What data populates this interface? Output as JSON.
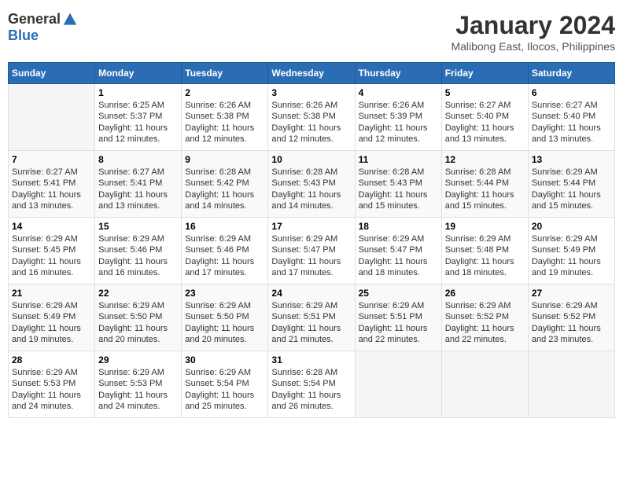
{
  "logo": {
    "general": "General",
    "blue": "Blue"
  },
  "title": "January 2024",
  "subtitle": "Malibong East, Ilocos, Philippines",
  "days_header": [
    "Sunday",
    "Monday",
    "Tuesday",
    "Wednesday",
    "Thursday",
    "Friday",
    "Saturday"
  ],
  "weeks": [
    [
      {
        "day": "",
        "info": ""
      },
      {
        "day": "1",
        "info": "Sunrise: 6:25 AM\nSunset: 5:37 PM\nDaylight: 11 hours\nand 12 minutes."
      },
      {
        "day": "2",
        "info": "Sunrise: 6:26 AM\nSunset: 5:38 PM\nDaylight: 11 hours\nand 12 minutes."
      },
      {
        "day": "3",
        "info": "Sunrise: 6:26 AM\nSunset: 5:38 PM\nDaylight: 11 hours\nand 12 minutes."
      },
      {
        "day": "4",
        "info": "Sunrise: 6:26 AM\nSunset: 5:39 PM\nDaylight: 11 hours\nand 12 minutes."
      },
      {
        "day": "5",
        "info": "Sunrise: 6:27 AM\nSunset: 5:40 PM\nDaylight: 11 hours\nand 13 minutes."
      },
      {
        "day": "6",
        "info": "Sunrise: 6:27 AM\nSunset: 5:40 PM\nDaylight: 11 hours\nand 13 minutes."
      }
    ],
    [
      {
        "day": "7",
        "info": "Sunrise: 6:27 AM\nSunset: 5:41 PM\nDaylight: 11 hours\nand 13 minutes."
      },
      {
        "day": "8",
        "info": "Sunrise: 6:27 AM\nSunset: 5:41 PM\nDaylight: 11 hours\nand 13 minutes."
      },
      {
        "day": "9",
        "info": "Sunrise: 6:28 AM\nSunset: 5:42 PM\nDaylight: 11 hours\nand 14 minutes."
      },
      {
        "day": "10",
        "info": "Sunrise: 6:28 AM\nSunset: 5:43 PM\nDaylight: 11 hours\nand 14 minutes."
      },
      {
        "day": "11",
        "info": "Sunrise: 6:28 AM\nSunset: 5:43 PM\nDaylight: 11 hours\nand 15 minutes."
      },
      {
        "day": "12",
        "info": "Sunrise: 6:28 AM\nSunset: 5:44 PM\nDaylight: 11 hours\nand 15 minutes."
      },
      {
        "day": "13",
        "info": "Sunrise: 6:29 AM\nSunset: 5:44 PM\nDaylight: 11 hours\nand 15 minutes."
      }
    ],
    [
      {
        "day": "14",
        "info": "Sunrise: 6:29 AM\nSunset: 5:45 PM\nDaylight: 11 hours\nand 16 minutes."
      },
      {
        "day": "15",
        "info": "Sunrise: 6:29 AM\nSunset: 5:46 PM\nDaylight: 11 hours\nand 16 minutes."
      },
      {
        "day": "16",
        "info": "Sunrise: 6:29 AM\nSunset: 5:46 PM\nDaylight: 11 hours\nand 17 minutes."
      },
      {
        "day": "17",
        "info": "Sunrise: 6:29 AM\nSunset: 5:47 PM\nDaylight: 11 hours\nand 17 minutes."
      },
      {
        "day": "18",
        "info": "Sunrise: 6:29 AM\nSunset: 5:47 PM\nDaylight: 11 hours\nand 18 minutes."
      },
      {
        "day": "19",
        "info": "Sunrise: 6:29 AM\nSunset: 5:48 PM\nDaylight: 11 hours\nand 18 minutes."
      },
      {
        "day": "20",
        "info": "Sunrise: 6:29 AM\nSunset: 5:49 PM\nDaylight: 11 hours\nand 19 minutes."
      }
    ],
    [
      {
        "day": "21",
        "info": "Sunrise: 6:29 AM\nSunset: 5:49 PM\nDaylight: 11 hours\nand 19 minutes."
      },
      {
        "day": "22",
        "info": "Sunrise: 6:29 AM\nSunset: 5:50 PM\nDaylight: 11 hours\nand 20 minutes."
      },
      {
        "day": "23",
        "info": "Sunrise: 6:29 AM\nSunset: 5:50 PM\nDaylight: 11 hours\nand 20 minutes."
      },
      {
        "day": "24",
        "info": "Sunrise: 6:29 AM\nSunset: 5:51 PM\nDaylight: 11 hours\nand 21 minutes."
      },
      {
        "day": "25",
        "info": "Sunrise: 6:29 AM\nSunset: 5:51 PM\nDaylight: 11 hours\nand 22 minutes."
      },
      {
        "day": "26",
        "info": "Sunrise: 6:29 AM\nSunset: 5:52 PM\nDaylight: 11 hours\nand 22 minutes."
      },
      {
        "day": "27",
        "info": "Sunrise: 6:29 AM\nSunset: 5:52 PM\nDaylight: 11 hours\nand 23 minutes."
      }
    ],
    [
      {
        "day": "28",
        "info": "Sunrise: 6:29 AM\nSunset: 5:53 PM\nDaylight: 11 hours\nand 24 minutes."
      },
      {
        "day": "29",
        "info": "Sunrise: 6:29 AM\nSunset: 5:53 PM\nDaylight: 11 hours\nand 24 minutes."
      },
      {
        "day": "30",
        "info": "Sunrise: 6:29 AM\nSunset: 5:54 PM\nDaylight: 11 hours\nand 25 minutes."
      },
      {
        "day": "31",
        "info": "Sunrise: 6:28 AM\nSunset: 5:54 PM\nDaylight: 11 hours\nand 26 minutes."
      },
      {
        "day": "",
        "info": ""
      },
      {
        "day": "",
        "info": ""
      },
      {
        "day": "",
        "info": ""
      }
    ]
  ]
}
